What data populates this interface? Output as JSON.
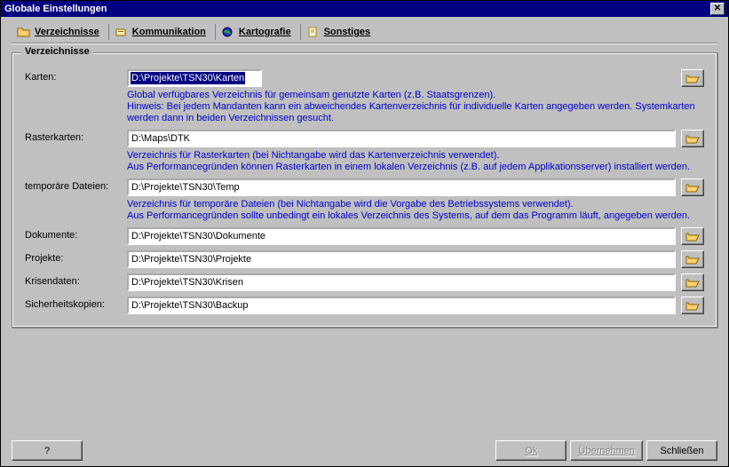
{
  "window": {
    "title": "Globale Einstellungen"
  },
  "tabs": {
    "verzeichnisse": "Verzeichnisse",
    "kommunikation": "Kommunikation",
    "kartografie": "Kartografie",
    "sonstiges": "Sonstiges"
  },
  "group_title": "Verzeichnisse",
  "labels": {
    "karten": "Karten:",
    "rasterkarten": "Rasterkarten:",
    "temp": "temporäre Dateien:",
    "dokumente": "Dokumente:",
    "projekte": "Projekte:",
    "krisendaten": "Krisendaten:",
    "sicherheit": "Sicherheitskopien:"
  },
  "values": {
    "karten": "D:\\Projekte\\TSN30\\Karten",
    "rasterkarten": "D:\\Maps\\DTK",
    "temp": "D:\\Projekte\\TSN30\\Temp",
    "dokumente": "D:\\Projekte\\TSN30\\Dokumente",
    "projekte": "D:\\Projekte\\TSN30\\Projekte",
    "krisendaten": "D:\\Projekte\\TSN30\\Krisen",
    "sicherheit": "D:\\Projekte\\TSN30\\Backup"
  },
  "hints": {
    "karten": "Global verfügbares Verzeichnis für gemeinsam genutzte Karten (z.B. Staatsgrenzen).\nHinweis: Bei jedem Mandanten kann ein abweichendes Kartenverzeichnis für individuelle Karten angegeben werden. Systemkarten werden dann in beiden Verzeichnissen gesucht.",
    "rasterkarten": "Verzeichnis für Rasterkarten (bei Nichtangabe wird das Kartenverzeichnis verwendet).\nAus Performancegründen können Rasterkarten in einem lokalen Verzeichnis (z.B. auf jedem Applikationsserver) installiert werden.",
    "temp": "Verzeichnis für temporäre Dateien (bei Nichtangabe wird die Vorgabe des Betriebssystems verwendet).\nAus Performancegründen sollte unbedingt ein lokales Verzeichnis des Systems, auf dem das Programm läuft, angegeben werden."
  },
  "buttons": {
    "help": "?",
    "ok": "Ok",
    "apply": "Übernehmen",
    "close": "Schließen"
  }
}
